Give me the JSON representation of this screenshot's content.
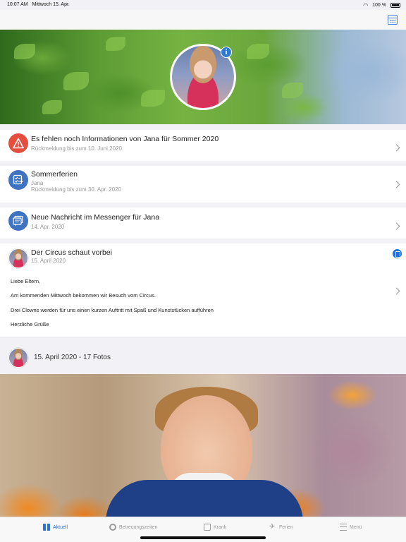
{
  "status_bar": {
    "time": "10:07 AM",
    "date": "Mittwoch 15. Apr.",
    "battery": "100 %"
  },
  "header": {
    "calendar_icon": "calendar-icon",
    "info_icon": "info-icon"
  },
  "feed": {
    "missing_info": {
      "title": "Es fehlen noch Informationen von Jana für Sommer 2020",
      "subtitle": "Rückmeldung bis zum 10. Juni 2020",
      "icon": "warning-icon",
      "icon_color": "#e54d3c"
    },
    "holidays": {
      "title": "Sommerferien",
      "child": "Jana",
      "subtitle": "Rückmeldung bis zum 30. Apr. 2020",
      "icon": "checklist-icon",
      "icon_color": "#3d73c1"
    },
    "message": {
      "title": "Neue Nachricht im Messenger für Jana",
      "date": "14. Apr. 2020",
      "icon": "message-icon"
    },
    "post": {
      "title": "Der Circus schaut vorbei",
      "date": "15. April 2020",
      "lines": [
        "Liebe Eltern,",
        "Am kommenden Mittwoch bekommen wir Besuch vom Circus.",
        "Drei Clowns werden für uns einen kurzen Auftritt mit Spaß und Kunststücken aufführen",
        "Herzliche Grüße"
      ],
      "attachment_icon": "clipboard-icon"
    },
    "photos": {
      "label": "15. April 2020 - 17 Fotos"
    }
  },
  "tabbar": {
    "tabs": [
      {
        "label": "Aktuell",
        "icon": "news-icon",
        "active": true
      },
      {
        "label": "Betreuungszeiten",
        "icon": "clock-icon",
        "active": false
      },
      {
        "label": "Krank",
        "icon": "thermometer-icon",
        "active": false
      },
      {
        "label": "Ferien",
        "icon": "plane-icon",
        "active": false
      },
      {
        "label": "Menü",
        "icon": "menu-icon",
        "active": false
      }
    ]
  },
  "colors": {
    "accent": "#2f72d4",
    "warning": "#e54d3c"
  }
}
